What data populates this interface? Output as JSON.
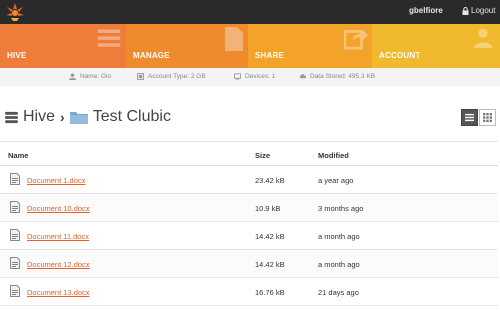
{
  "header": {
    "username": "gbelfiore",
    "logout_label": "Logout"
  },
  "nav": {
    "tiles": [
      {
        "label": "HIVE"
      },
      {
        "label": "MANAGE"
      },
      {
        "label": "SHARE"
      },
      {
        "label": "ACCOUNT"
      }
    ]
  },
  "info": {
    "name": "Name: Gio",
    "account_type": "Account Type: 2 GB",
    "devices": "Devices: 1",
    "data_stored": "Data Stored: 495.3 KB"
  },
  "breadcrumb": {
    "root": "Hive",
    "separator": "›",
    "current": "Test Clubic"
  },
  "table": {
    "headers": {
      "name": "Name",
      "size": "Size",
      "modified": "Modified"
    },
    "rows": [
      {
        "name": "Document 1.docx",
        "size": "23.42 kB",
        "modified": "a year ago"
      },
      {
        "name": "Document 10.docx",
        "size": "10.9 kB",
        "modified": "3 months ago"
      },
      {
        "name": "Document 11.docx",
        "size": "14.42 kB",
        "modified": "a month ago"
      },
      {
        "name": "Document 12.docx",
        "size": "14.42 kB",
        "modified": "a month ago"
      },
      {
        "name": "Document 13.docx",
        "size": "16.76 kB",
        "modified": "21 days ago"
      }
    ]
  },
  "colors": {
    "hive": "#ee7d3a",
    "manage": "#ef8b2c",
    "share": "#f3a32a",
    "account": "#f0b92e",
    "link": "#e0622a"
  }
}
